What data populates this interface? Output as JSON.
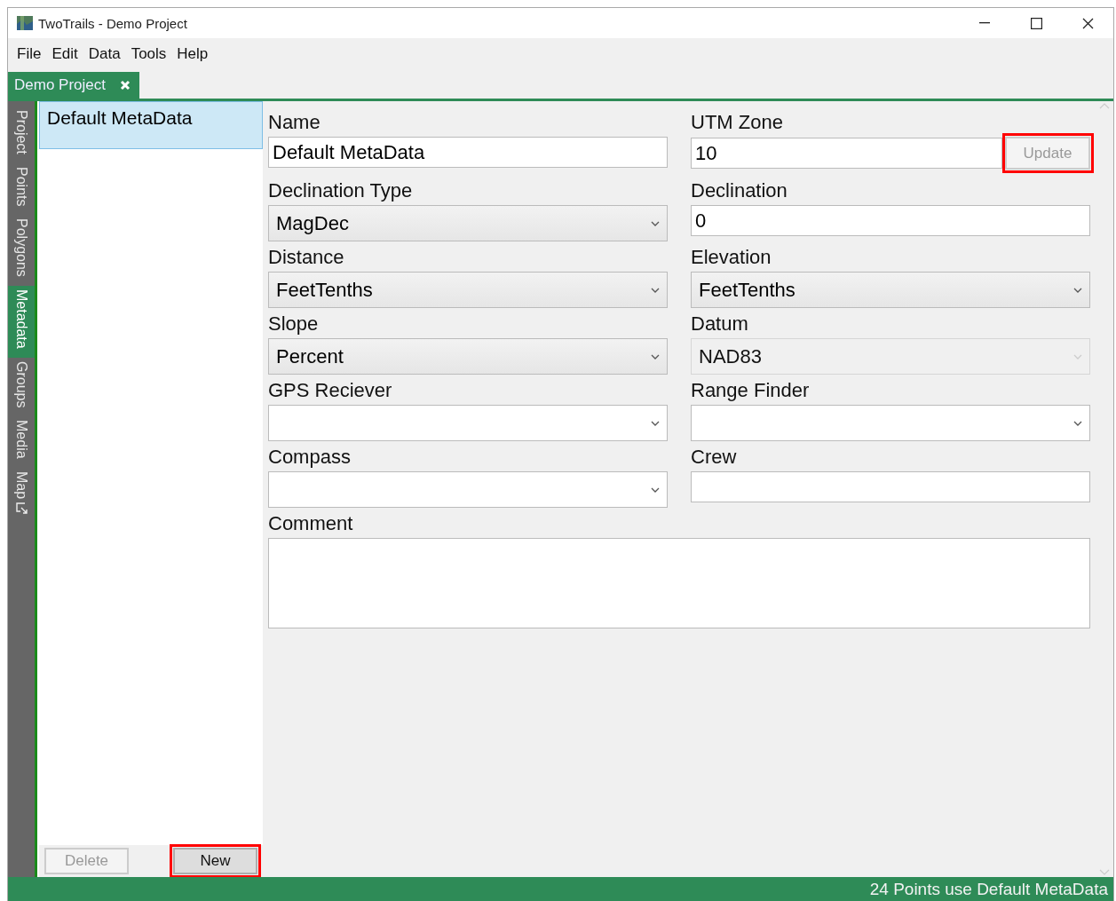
{
  "window": {
    "title": "TwoTrails - Demo Project"
  },
  "menu": [
    "File",
    "Edit",
    "Data",
    "Tools",
    "Help"
  ],
  "doc_tabs": [
    {
      "label": "Demo Project",
      "selected": true
    }
  ],
  "side_tabs": [
    {
      "label": "Project",
      "selected": false,
      "kind": "plain"
    },
    {
      "label": "Points",
      "selected": false,
      "kind": "plain"
    },
    {
      "label": "Polygons",
      "selected": false,
      "kind": "plain"
    },
    {
      "label": "Metadata",
      "selected": true,
      "kind": "plain"
    },
    {
      "label": "Groups",
      "selected": false,
      "kind": "plain"
    },
    {
      "label": "Media",
      "selected": false,
      "kind": "plain"
    },
    {
      "label": "Map",
      "selected": false,
      "kind": "external"
    }
  ],
  "metadata_list": {
    "items": [
      {
        "label": "Default MetaData",
        "selected": true
      }
    ],
    "buttons": [
      {
        "label": "Delete",
        "disabled": true,
        "highlighted": false
      },
      {
        "label": "New",
        "disabled": false,
        "highlighted": true
      }
    ]
  },
  "form": {
    "fields": [
      {
        "label": "Name",
        "kind": "text",
        "value": "Default MetaData"
      },
      {
        "label": "UTM Zone",
        "kind": "text",
        "value": "10",
        "button": {
          "label": "Update",
          "disabled": true,
          "highlighted": true
        }
      },
      {
        "label": "Declination Type",
        "kind": "combo",
        "value": "MagDec",
        "disabled": false
      },
      {
        "label": "Declination",
        "kind": "text",
        "value": "0"
      },
      {
        "label": "Distance",
        "kind": "combo",
        "value": "FeetTenths",
        "disabled": false
      },
      {
        "label": "Elevation",
        "kind": "combo",
        "value": "FeetTenths",
        "disabled": false
      },
      {
        "label": "Slope",
        "kind": "combo",
        "value": "Percent",
        "disabled": false
      },
      {
        "label": "Datum",
        "kind": "combo",
        "value": "NAD83",
        "disabled": true
      },
      {
        "label": "GPS Reciever",
        "kind": "combo",
        "disabled": false
      },
      {
        "label": "Range Finder",
        "kind": "combo",
        "disabled": false
      },
      {
        "label": "Compass",
        "kind": "combo",
        "disabled": false
      },
      {
        "label": "Crew",
        "kind": "text"
      },
      {
        "label": "Comment",
        "kind": "textarea"
      }
    ]
  },
  "status_bar": {
    "text": "24 Points use Default MetaData"
  }
}
